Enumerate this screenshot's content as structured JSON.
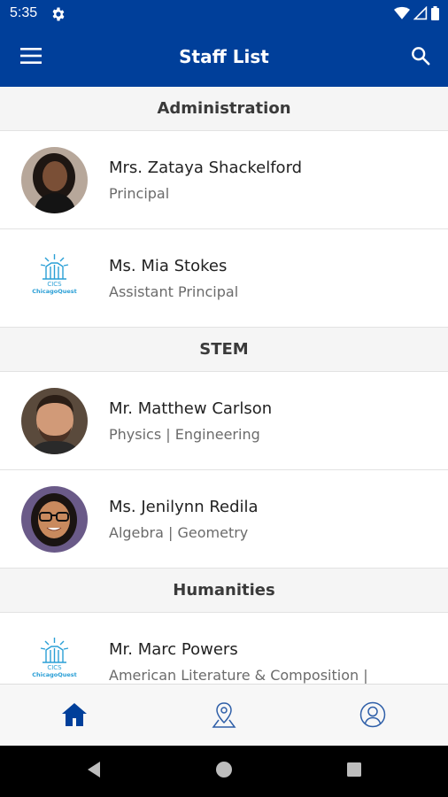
{
  "status_bar": {
    "time": "5:35"
  },
  "app_bar": {
    "title": "Staff List"
  },
  "sections": [
    {
      "title": "Administration",
      "staff": [
        {
          "name": "Mrs. Zataya Shackelford",
          "role": "Principal",
          "avatar": "photo"
        },
        {
          "name": "Ms. Mia Stokes",
          "role": "Assistant Principal",
          "avatar": "school-logo"
        }
      ]
    },
    {
      "title": "STEM",
      "staff": [
        {
          "name": "Mr. Matthew Carlson",
          "role": "Physics | Engineering",
          "avatar": "photo"
        },
        {
          "name": "Ms. Jenilynn Redila",
          "role": "Algebra | Geometry",
          "avatar": "photo"
        }
      ]
    },
    {
      "title": "Humanities",
      "staff": [
        {
          "name": "Mr. Marc Powers",
          "role": "American Literature & Composition |",
          "avatar": "school-logo"
        }
      ]
    }
  ],
  "logo": {
    "line1": "CICS",
    "line2": "ChicagoQuest"
  },
  "bottom_nav": [
    {
      "icon": "home-icon",
      "active": true
    },
    {
      "icon": "location-icon",
      "active": false
    },
    {
      "icon": "profile-icon",
      "active": false
    }
  ],
  "colors": {
    "primary": "#003f9a",
    "logo": "#2a9fd6",
    "section_bg": "#f5f5f5"
  }
}
